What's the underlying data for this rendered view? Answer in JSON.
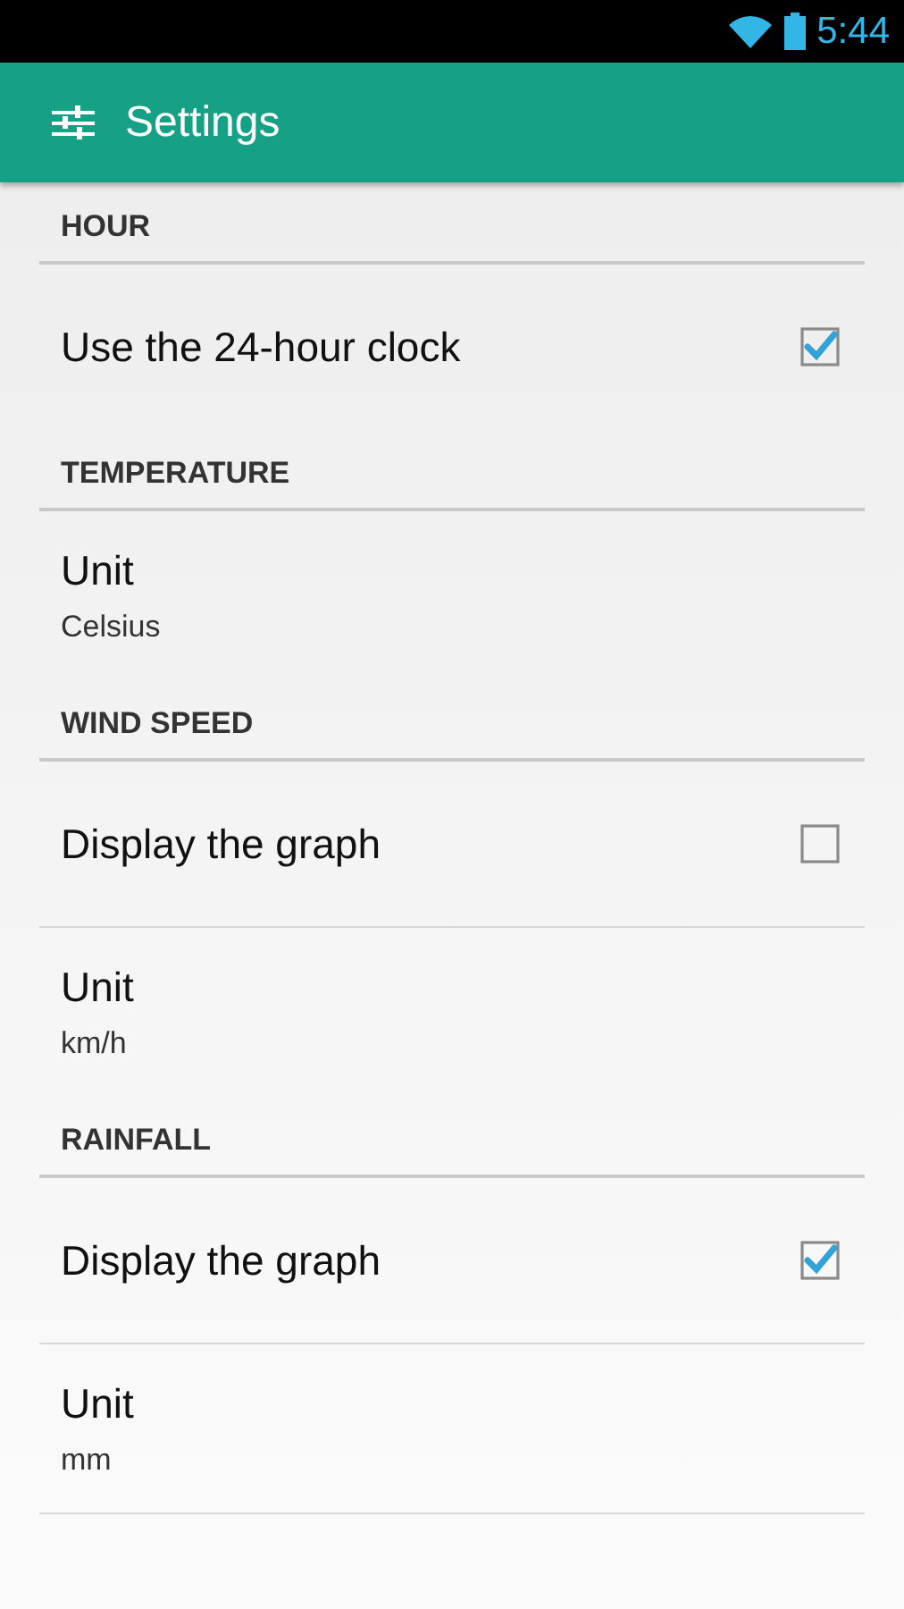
{
  "status_bar": {
    "time": "5:44"
  },
  "app_bar": {
    "title": "Settings"
  },
  "categories": [
    {
      "title": "HOUR",
      "items": [
        {
          "kind": "checkbox",
          "title": "Use the 24-hour clock",
          "checked": true
        }
      ]
    },
    {
      "title": "TEMPERATURE",
      "items": [
        {
          "kind": "value",
          "title": "Unit",
          "summary": "Celsius"
        }
      ]
    },
    {
      "title": "WIND SPEED",
      "items": [
        {
          "kind": "checkbox",
          "title": "Display the graph",
          "checked": false
        },
        {
          "kind": "value",
          "title": "Unit",
          "summary": "km/h"
        }
      ]
    },
    {
      "title": "RAINFALL",
      "items": [
        {
          "kind": "checkbox",
          "title": "Display the graph",
          "checked": true
        },
        {
          "kind": "value",
          "title": "Unit",
          "summary": "mm"
        }
      ]
    }
  ]
}
